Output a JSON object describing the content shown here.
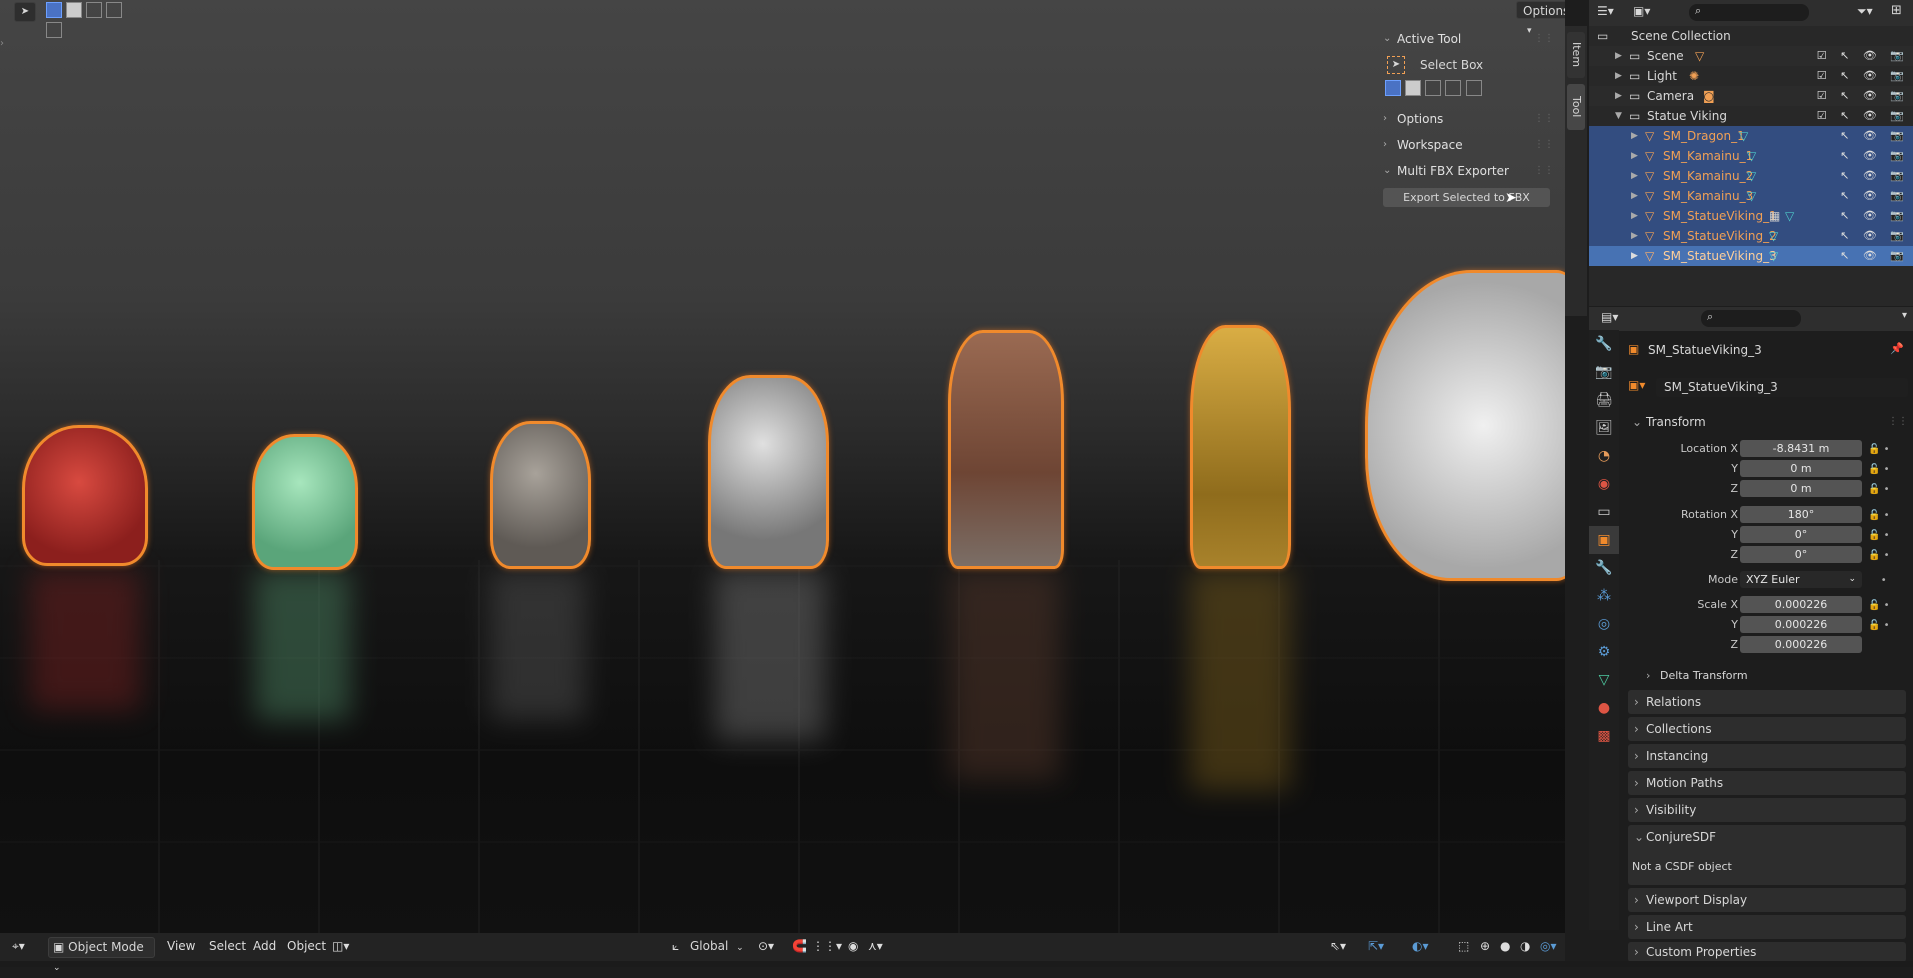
{
  "viewport": {
    "options_label": "Options",
    "statues": [
      {
        "name": "red-foo-dog-statue",
        "color": "#b3302c"
      },
      {
        "name": "jade-foo-dog-statue",
        "color": "#7fc99a"
      },
      {
        "name": "stone-foo-dog-statue",
        "color": "#8b8580"
      },
      {
        "name": "silver-titan-statue",
        "color": "#a8a8a8"
      },
      {
        "name": "copper-viking-statue",
        "color": "#8a5a44"
      },
      {
        "name": "golden-valkyrie-statue",
        "color": "#b08a2a"
      },
      {
        "name": "white-dragon-statue",
        "color": "#d8d8d8"
      }
    ]
  },
  "sidebar_tabs": {
    "item": "Item",
    "tool": "Tool"
  },
  "tool_panel": {
    "active_tool_header": "Active Tool",
    "active_tool_name": "Select Box",
    "options_header": "Options",
    "workspace_header": "Workspace",
    "exporter_header": "Multi FBX Exporter",
    "export_button": "Export Selected to FBX"
  },
  "outliner": {
    "search_placeholder": "",
    "rows": [
      {
        "label": "Scene Collection"
      },
      {
        "label": "Scene"
      },
      {
        "label": "Light"
      },
      {
        "label": "Camera"
      },
      {
        "label": "Statue Viking"
      },
      {
        "label": "SM_Dragon_1"
      },
      {
        "label": "SM_Kamainu_1"
      },
      {
        "label": "SM_Kamainu_2"
      },
      {
        "label": "SM_Kamainu_3"
      },
      {
        "label": "SM_StatueViking_1"
      },
      {
        "label": "SM_StatueViking_2"
      },
      {
        "label": "SM_StatueViking_3"
      }
    ]
  },
  "properties": {
    "object_name": "SM_StatueViking_3",
    "object_field": "SM_StatueViking_3",
    "transform_header": "Transform",
    "location_x_label": "Location X",
    "location_x": "-8.8431 m",
    "y_label": "Y",
    "z_label": "Z",
    "location_y": "0 m",
    "location_z": "0 m",
    "rotation_x_label": "Rotation X",
    "rotation_x": "180°",
    "rotation_y": "0°",
    "rotation_z": "0°",
    "mode_label": "Mode",
    "mode_value": "XYZ Euler",
    "scale_x_label": "Scale X",
    "scale_x": "0.000226",
    "scale_y": "0.000226",
    "scale_z": "0.000226",
    "delta_transform": "Delta Transform",
    "relations": "Relations",
    "collections": "Collections",
    "instancing": "Instancing",
    "motion_paths": "Motion Paths",
    "visibility": "Visibility",
    "conjure_header": "ConjureSDF",
    "conjure_text": "Not a CSDF object",
    "viewport_display": "Viewport Display",
    "line_art": "Line Art",
    "custom_properties": "Custom Properties"
  },
  "bottom_bar": {
    "mode": "Object Mode",
    "view": "View",
    "select": "Select",
    "add": "Add",
    "object": "Object",
    "orientation": "Global"
  },
  "colors": {
    "accent": "#f08a2c",
    "selection": "#334d80",
    "orange_text": "#f1a055"
  }
}
